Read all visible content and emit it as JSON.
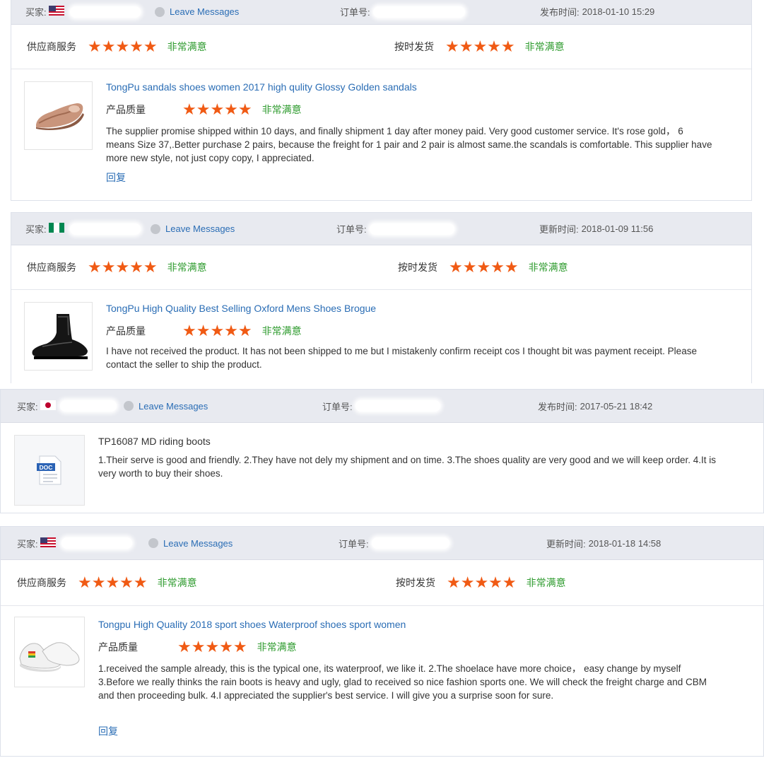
{
  "labels": {
    "buyer": "买家:",
    "leave_messages": "Leave Messages",
    "order_no": "订单号:",
    "supplier_service": "供应商服务",
    "on_time_delivery": "按时发货",
    "product_quality": "产品质量",
    "very_satisfied": "非常满意",
    "reply": "回复",
    "stars": "★★★★★"
  },
  "reviews": [
    {
      "flag": "us",
      "date_label": "发布时间:",
      "date": "2018-01-10 15:29",
      "product_title": "TongPu sandals shoes women 2017 high qulity Glossy Golden sandals",
      "text": "The supplier promise shipped within 10 days, and finally shipment 1 day after money paid. Very good customer service. It's rose gold， 6 means Size 37,.Better purchase 2 pairs, because the freight for 1 pair and 2 pair is almost same.the scandals is comfortable. This supplier have more new style, not just copy copy, I appreciated.",
      "reply": "回复"
    },
    {
      "flag": "ng",
      "date_label": "更新时间:",
      "date": "2018-01-09 11:56",
      "product_title": "TongPu High Quality Best Selling Oxford Mens Shoes Brogue",
      "text": "I have not received the product. It has not been shipped to me but I mistakenly confirm receipt cos I thought bit was payment receipt. Please contact the seller to ship the product."
    },
    {
      "flag": "jp",
      "date_label": "发布时间:",
      "date": "2017-05-21 18:42",
      "product_title": "TP16087 MD riding boots",
      "doc_icon_text": "DOC",
      "text": "1.Their serve is good and friendly. 2.They have not dely my shipment and on time. 3.The shoes quality are very good and we will keep order.  4.It is very worth to buy their shoes."
    },
    {
      "flag": "us",
      "date_label": "更新时间:",
      "date": "2018-01-18 14:58",
      "product_title": "Tongpu High Quality 2018 sport shoes Waterproof shoes sport women",
      "text": "1.received the sample already, this is the typical one, its waterproof, we like it. 2.The shoelace have more choice， easy change by myself 3.Before we really thinks the rain boots is heavy and ugly, glad to received so nice fashion sports one. We will check the freight charge and CBM and then proceeding bulk. 4.I appreciated the supplier's best service. I will give you a surprise soon for sure.",
      "reply": "回复"
    }
  ],
  "colors": {
    "star": "#f05a14",
    "satisfied": "#2e9b2e",
    "link": "#2a6db5",
    "header_bg": "#e8eaf0"
  }
}
